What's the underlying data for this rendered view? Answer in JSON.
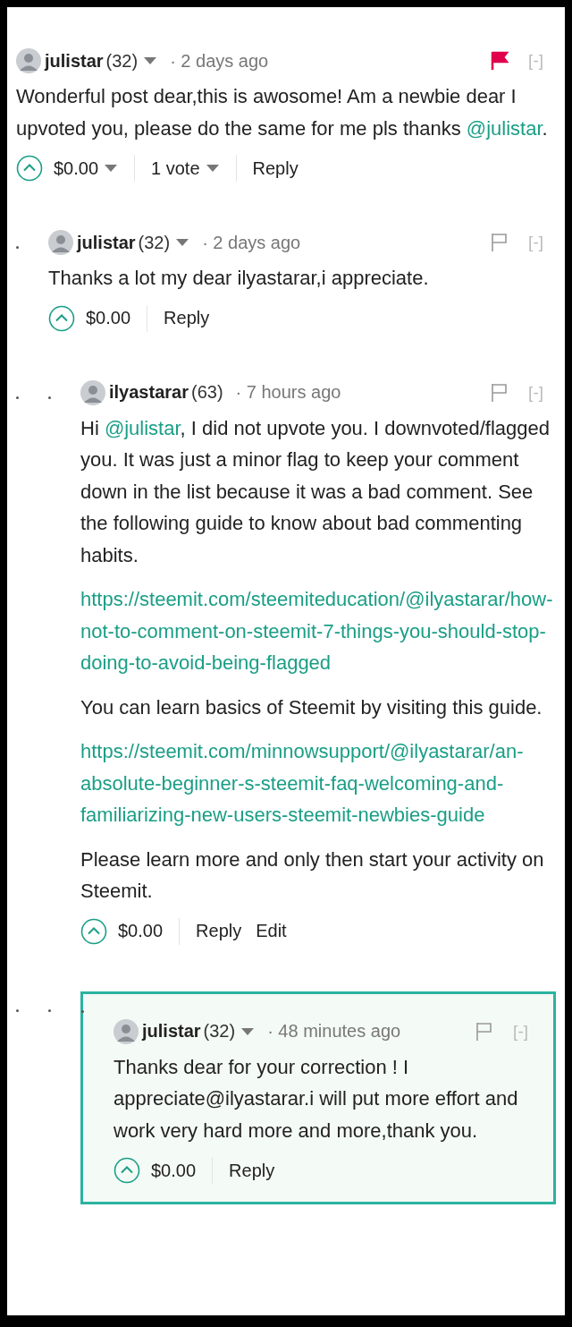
{
  "comments": [
    {
      "author": "julistar",
      "reputation": "(32)",
      "author_menu": true,
      "time": "· 2 days ago",
      "flagged": true,
      "highlighted": false,
      "collapse": "[-]",
      "body": [
        {
          "kind": "text",
          "segments": [
            {
              "text": "Wonderful post dear,this is awosome! Am a newbie dear I upvoted you, please do the same for me pls thanks "
            },
            {
              "text": "@julistar",
              "link": true
            },
            {
              "text": "."
            }
          ]
        }
      ],
      "payout": "$0.00",
      "payout_menu": true,
      "votes": "1 vote",
      "actions": [
        "Reply"
      ],
      "children": [
        {
          "author": "julistar",
          "reputation": "(32)",
          "author_menu": true,
          "time": "· 2 days ago",
          "flagged": false,
          "highlighted": false,
          "collapse": "[-]",
          "body": [
            {
              "kind": "text",
              "segments": [
                {
                  "text": "Thanks a lot my dear ilyastarar,i appreciate."
                }
              ]
            }
          ],
          "payout": "$0.00",
          "payout_menu": false,
          "actions": [
            "Reply"
          ],
          "children": [
            {
              "author": "ilyastarar",
              "reputation": "(63)",
              "author_menu": false,
              "time": "· 7 hours ago",
              "flagged": false,
              "highlighted": false,
              "collapse": "[-]",
              "body": [
                {
                  "kind": "text",
                  "segments": [
                    {
                      "text": "Hi "
                    },
                    {
                      "text": "@julistar",
                      "link": true
                    },
                    {
                      "text": ", I did not upvote you. I downvoted/flagged you. It was just a minor flag to keep your comment down in the list because it was a bad comment. See the following guide to know about bad commenting habits."
                    }
                  ]
                },
                {
                  "kind": "link",
                  "text": "https://steemit.com/steemiteducation/@ilyastarar/how-not-to-comment-on-steemit-7-things-you-should-stop-doing-to-avoid-being-flagged"
                },
                {
                  "kind": "text",
                  "segments": [
                    {
                      "text": "You can learn basics of Steemit by visiting this guide."
                    }
                  ]
                },
                {
                  "kind": "link",
                  "text": "https://steemit.com/minnowsupport/@ilyastarar/an-absolute-beginner-s-steemit-faq-welcoming-and-familiarizing-new-users-steemit-newbies-guide"
                },
                {
                  "kind": "text",
                  "segments": [
                    {
                      "text": "Please learn more and only then start your activity on Steemit."
                    }
                  ]
                }
              ],
              "payout": "$0.00",
              "payout_menu": false,
              "actions": [
                "Reply",
                "Edit"
              ],
              "children": [
                {
                  "author": "julistar",
                  "reputation": "(32)",
                  "author_menu": true,
                  "time": "· 48 minutes ago",
                  "flagged": false,
                  "highlighted": true,
                  "collapse": "[-]",
                  "body": [
                    {
                      "kind": "text",
                      "segments": [
                        {
                          "text": "Thanks dear for your correction ! I appreciate@ilyastarar.i will put more effort and work very hard more and more,thank you."
                        }
                      ]
                    }
                  ],
                  "payout": "$0.00",
                  "payout_menu": false,
                  "actions": [
                    "Reply"
                  ]
                }
              ]
            }
          ]
        }
      ]
    }
  ]
}
